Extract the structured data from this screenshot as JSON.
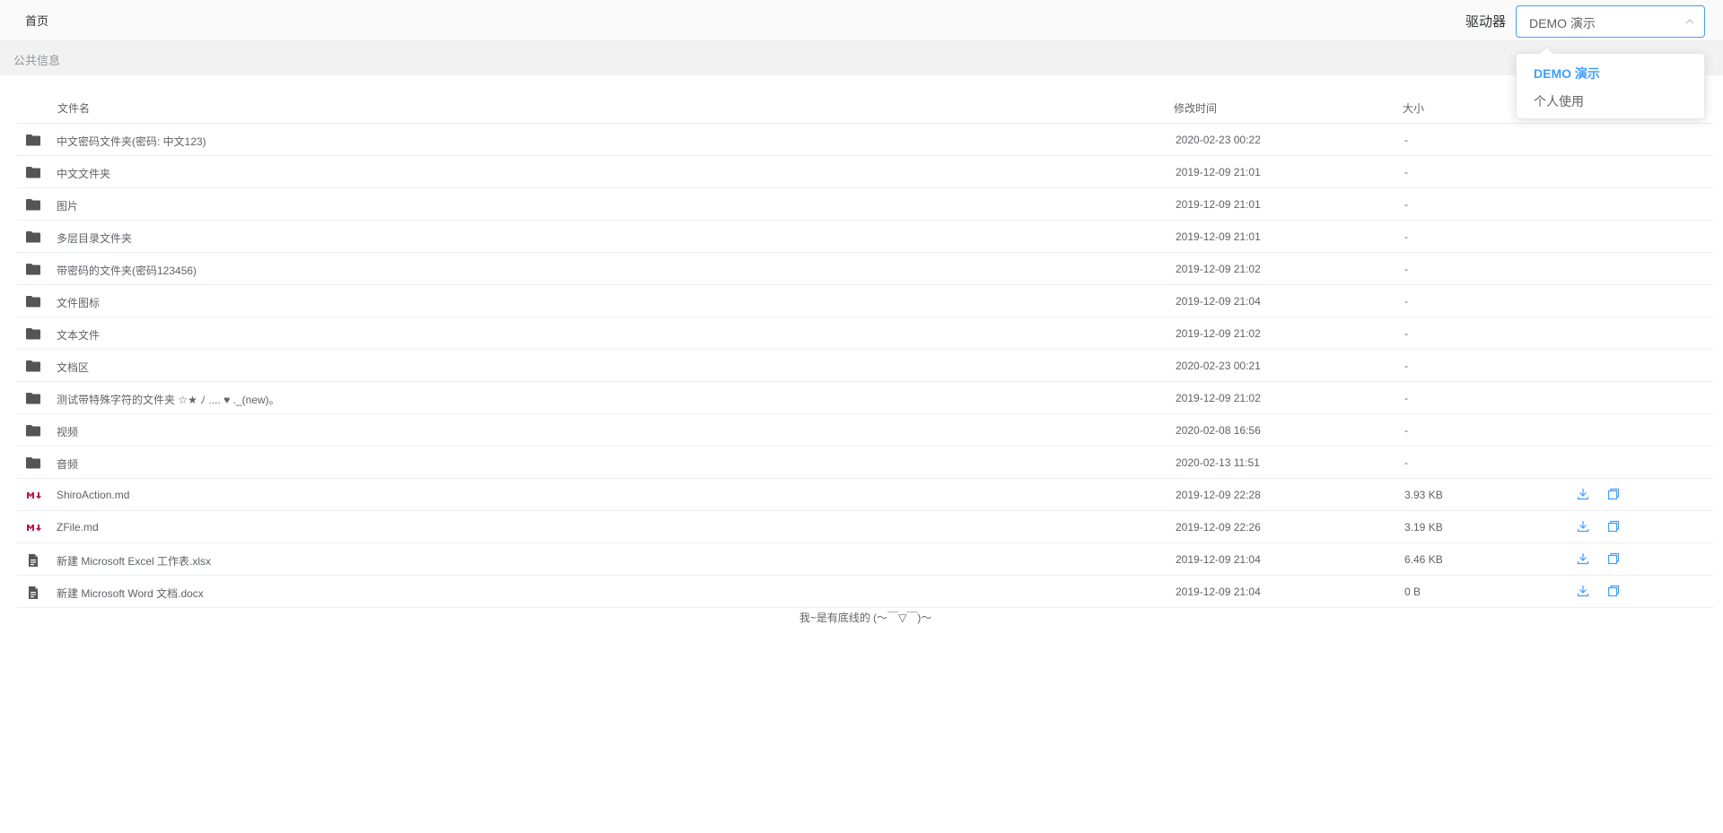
{
  "header": {
    "home_label": "首页",
    "drive_label": "驱动器",
    "drive_selected": "DEMO 演示"
  },
  "breadcrumb": "公共信息",
  "table": {
    "columns": {
      "name": "文件名",
      "time": "修改时间",
      "size": "大小"
    },
    "rows": [
      {
        "type": "folder",
        "icon": "folder-icon",
        "name": "中文密码文件夹(密码: 中文123)",
        "time": "2020-02-23 00:22",
        "size": "-"
      },
      {
        "type": "folder",
        "icon": "folder-icon",
        "name": "中文文件夹",
        "time": "2019-12-09 21:01",
        "size": "-"
      },
      {
        "type": "folder",
        "icon": "folder-icon",
        "name": "图片",
        "time": "2019-12-09 21:01",
        "size": "-"
      },
      {
        "type": "folder",
        "icon": "folder-icon",
        "name": "多层目录文件夹",
        "time": "2019-12-09 21:01",
        "size": "-"
      },
      {
        "type": "folder",
        "icon": "folder-icon",
        "name": "带密码的文件夹(密码123456)",
        "time": "2019-12-09 21:02",
        "size": "-"
      },
      {
        "type": "folder",
        "icon": "folder-icon",
        "name": "文件图标",
        "time": "2019-12-09 21:04",
        "size": "-"
      },
      {
        "type": "folder",
        "icon": "folder-icon",
        "name": "文本文件",
        "time": "2019-12-09 21:02",
        "size": "-"
      },
      {
        "type": "folder",
        "icon": "folder-icon",
        "name": "文档区",
        "time": "2020-02-23 00:21",
        "size": "-"
      },
      {
        "type": "folder",
        "icon": "folder-icon",
        "name": "测试带特殊字符的文件夹 ☆★ ﾉ .... ♥ ._(new)。",
        "time": "2019-12-09 21:02",
        "size": "-"
      },
      {
        "type": "folder",
        "icon": "folder-icon",
        "name": "视频",
        "time": "2020-02-08 16:56",
        "size": "-"
      },
      {
        "type": "folder",
        "icon": "folder-icon",
        "name": "音频",
        "time": "2020-02-13 11:51",
        "size": "-"
      },
      {
        "type": "file",
        "icon": "markdown-icon",
        "name": "ShiroAction.md",
        "time": "2019-12-09 22:28",
        "size": "3.93 KB"
      },
      {
        "type": "file",
        "icon": "markdown-icon",
        "name": "ZFile.md",
        "time": "2019-12-09 22:26",
        "size": "3.19 KB"
      },
      {
        "type": "file",
        "icon": "document-icon",
        "name": "新建 Microsoft Excel 工作表.xlsx",
        "time": "2019-12-09 21:04",
        "size": "6.46 KB"
      },
      {
        "type": "file",
        "icon": "document-icon",
        "name": "新建 Microsoft Word 文档.docx",
        "time": "2019-12-09 21:04",
        "size": "0 B"
      }
    ]
  },
  "footer_note": "我~是有底线的 (～￣▽￣)～",
  "dropdown": {
    "options": [
      "DEMO 演示",
      "个人使用"
    ],
    "selected_index": 0
  },
  "colors": {
    "accent": "#409eff",
    "markdown": "#b5164e",
    "folder": "#555555"
  }
}
